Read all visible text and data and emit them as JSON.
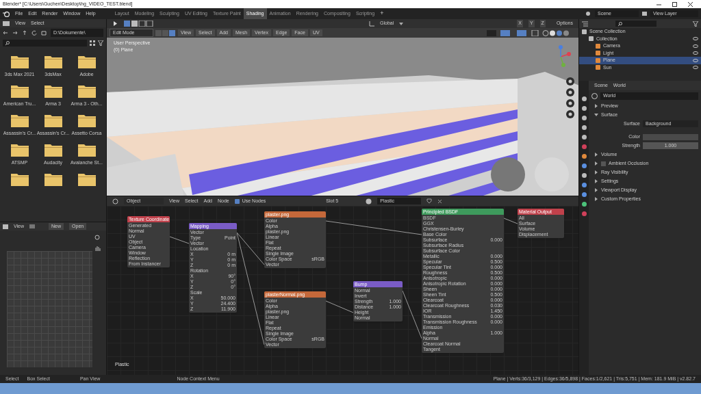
{
  "window": {
    "title": "Blender* [C:\\Users\\Guchen\\Desktop\\hg_VIDEO_TEST.blend]"
  },
  "menu": [
    "File",
    "Edit",
    "Render",
    "Window",
    "Help"
  ],
  "workspaces": [
    {
      "label": "Layout",
      "selected": false
    },
    {
      "label": "Modeling",
      "selected": false
    },
    {
      "label": "Sculpting",
      "selected": false
    },
    {
      "label": "UV Editing",
      "selected": false
    },
    {
      "label": "Texture Paint",
      "selected": false
    },
    {
      "label": "Shading",
      "selected": true
    },
    {
      "label": "Animation",
      "selected": false
    },
    {
      "label": "Rendering",
      "selected": false
    },
    {
      "label": "Compositing",
      "selected": false
    },
    {
      "label": "Scripting",
      "selected": false
    }
  ],
  "add_workspace": "+",
  "scene": "Scene",
  "view_layer": "View Layer",
  "file_browser": {
    "menu": [
      "View",
      "Select"
    ],
    "path": "D:\\Dokumente\\",
    "folders": [
      "3ds Max 2021",
      "3dsMax",
      "Adobe",
      "American Tru...",
      "Arma 3",
      "Arma 3 - Oth...",
      "Assassin's Cr...",
      "Assassin's Cr...",
      "Assetto Corsa",
      "ATSMP",
      "Audacity",
      "Avalanche St..."
    ]
  },
  "image_editor": {
    "menu": [
      "View"
    ],
    "new": "New",
    "open": "Open"
  },
  "viewport": {
    "mode": "Edit Mode",
    "menu": [
      "View",
      "Select",
      "Add",
      "Mesh",
      "Vertex",
      "Edge",
      "Face",
      "UV"
    ],
    "orientation": "Global",
    "axes": [
      "X",
      "Y",
      "Z"
    ],
    "options": "Options",
    "overlay": [
      "User Perspective",
      "(0) Plane"
    ]
  },
  "node_editor": {
    "object": "Object",
    "menu": [
      "View",
      "Select",
      "Add",
      "Node"
    ],
    "use_nodes": {
      "label": "Use Nodes",
      "checked": true
    },
    "slot": "Slot 5",
    "material": "Plastic",
    "label": "Plastic",
    "nodes": [
      {
        "title": "Texture Coordinate",
        "color": "#c0414b",
        "rows": [
          {
            "label": "Generated"
          },
          {
            "label": "Normal"
          },
          {
            "label": "UV"
          },
          {
            "label": "Object"
          },
          {
            "label": "Camera"
          },
          {
            "label": "Window"
          },
          {
            "label": "Reflection"
          },
          {
            "label": "From Instancer"
          }
        ]
      },
      {
        "title": "Mapping",
        "color": "#7a5cc6",
        "rows": [
          {
            "label": "Vector"
          },
          {
            "label": "Type",
            "value": "Point"
          },
          {
            "label": "Vector"
          },
          {
            "label": "Location"
          },
          {
            "label": "X",
            "value": "0 m"
          },
          {
            "label": "Y",
            "value": "0 m"
          },
          {
            "label": "Z",
            "value": "0 m"
          },
          {
            "label": "Rotation"
          },
          {
            "label": "X",
            "value": "90°"
          },
          {
            "label": "Y",
            "value": "0°"
          },
          {
            "label": "Z",
            "value": "0°"
          },
          {
            "label": "Scale"
          },
          {
            "label": "X",
            "value": "50.000"
          },
          {
            "label": "Y",
            "value": "24.400"
          },
          {
            "label": "Z",
            "value": "11.900"
          }
        ]
      },
      {
        "title": "plaster.png",
        "color": "#c4683a",
        "rows": [
          {
            "label": "Color"
          },
          {
            "label": "Alpha"
          },
          {
            "label": "plaster.png"
          },
          {
            "label": "Linear"
          },
          {
            "label": "Flat"
          },
          {
            "label": "Repeat"
          },
          {
            "label": "Single Image"
          },
          {
            "label": "Color Space",
            "value": "sRGB"
          },
          {
            "label": "Vector"
          }
        ]
      },
      {
        "title": "plasterNormal.png",
        "color": "#c4683a",
        "rows": [
          {
            "label": "Color"
          },
          {
            "label": "Alpha"
          },
          {
            "label": "plaster.png"
          },
          {
            "label": "Linear"
          },
          {
            "label": "Flat"
          },
          {
            "label": "Repeat"
          },
          {
            "label": "Single Image"
          },
          {
            "label": "Color Space",
            "value": "sRGB"
          },
          {
            "label": "Vector"
          }
        ]
      },
      {
        "title": "Bump",
        "color": "#7a5cc6",
        "rows": [
          {
            "label": "Normal"
          },
          {
            "label": "Invert"
          },
          {
            "label": "Strength",
            "value": "1.000"
          },
          {
            "label": "Distance",
            "value": "1.000"
          },
          {
            "label": "Height"
          },
          {
            "label": "Normal"
          }
        ]
      },
      {
        "title": "Principled BSDF",
        "color": "#3e9a5c",
        "rows": [
          {
            "label": "BSDF"
          },
          {
            "label": "GGX"
          },
          {
            "label": "Christensen-Burley"
          },
          {
            "label": "Base Color"
          },
          {
            "label": "Subsurface",
            "value": "0.000"
          },
          {
            "label": "Subsurface Radius"
          },
          {
            "label": "Subsurface Color"
          },
          {
            "label": "Metallic",
            "value": "0.000"
          },
          {
            "label": "Specular",
            "value": "0.500"
          },
          {
            "label": "Specular Tint",
            "value": "0.000"
          },
          {
            "label": "Roughness",
            "value": "0.500"
          },
          {
            "label": "Anisotropic",
            "value": "0.000"
          },
          {
            "label": "Anisotropic Rotation",
            "value": "0.000"
          },
          {
            "label": "Sheen",
            "value": "0.000"
          },
          {
            "label": "Sheen Tint",
            "value": "0.500"
          },
          {
            "label": "Clearcoat",
            "value": "0.000"
          },
          {
            "label": "Clearcoat Roughness",
            "value": "0.030"
          },
          {
            "label": "IOR",
            "value": "1.450"
          },
          {
            "label": "Transmission",
            "value": "0.000"
          },
          {
            "label": "Transmission Roughness",
            "value": "0.000"
          },
          {
            "label": "Emission"
          },
          {
            "label": "Alpha",
            "value": "1.000"
          },
          {
            "label": "Normal"
          },
          {
            "label": "Clearcoat Normal"
          },
          {
            "label": "Tangent"
          }
        ]
      },
      {
        "title": "Material Output",
        "color": "#c0414b",
        "rows": [
          {
            "label": "All"
          },
          {
            "label": "Surface"
          },
          {
            "label": "Volume"
          },
          {
            "label": "Displacement"
          }
        ]
      }
    ]
  },
  "outliner": {
    "items": [
      {
        "label": "Scene Collection",
        "selected": false,
        "children": [
          {
            "label": "Collection",
            "selected": false,
            "children": [
              {
                "label": "Camera",
                "selected": false
              },
              {
                "label": "Light",
                "selected": false
              },
              {
                "label": "Plane",
                "selected": true
              },
              {
                "label": "Sun",
                "selected": false
              }
            ]
          }
        ]
      }
    ]
  },
  "properties": {
    "tabs": [
      "Scene",
      "World"
    ],
    "world": "World",
    "panels": [
      {
        "kind": "panel",
        "label": "Preview",
        "expanded": false
      },
      {
        "kind": "panel",
        "label": "Surface",
        "expanded": true,
        "fields": [
          {
            "label": "Surface",
            "value": "Background"
          },
          {
            "label": "Color"
          },
          {
            "label": "Strength",
            "value": "1.000"
          }
        ]
      },
      {
        "kind": "panel",
        "label": "Volume",
        "expanded": false
      },
      {
        "kind": "check",
        "label": "Ambient Occlusion",
        "checked": false
      },
      {
        "kind": "panel",
        "label": "Ray Visibility",
        "expanded": false
      },
      {
        "kind": "panel",
        "label": "Settings",
        "expanded": false
      },
      {
        "kind": "panel",
        "label": "Viewport Display",
        "expanded": false
      },
      {
        "kind": "panel",
        "label": "Custom Properties",
        "expanded": false
      }
    ]
  },
  "status_bar": {
    "hints": [
      "Select",
      "Box Select",
      "Pan View",
      "Node Context Menu"
    ],
    "stats": "Plane | Verts:36/3,129 | Edges:36/5,898 | Faces:1/2,621 | Tris:5,751 | Mem: 181.9 MiB | v2.82.7"
  }
}
